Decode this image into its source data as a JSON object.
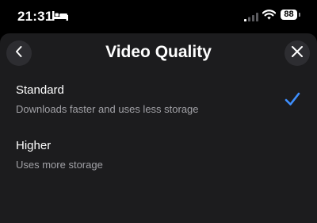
{
  "status_bar": {
    "time": "21:31",
    "battery": "88",
    "sleep_icon": "bed-icon",
    "signal_icon": "cellular-signal-icon",
    "wifi_icon": "wifi-icon"
  },
  "sheet": {
    "title": "Video Quality",
    "back_icon": "chevron-left-icon",
    "close_icon": "close-icon"
  },
  "options": [
    {
      "label": "Standard",
      "description": "Downloads faster and uses less storage",
      "selected": true
    },
    {
      "label": "Higher",
      "description": "Uses more storage",
      "selected": false
    }
  ],
  "colors": {
    "background": "#000000",
    "sheet": "#1c1c1e",
    "button": "#2d2d31",
    "secondary_text": "#a1a1a6",
    "accent": "#3e8fff"
  }
}
